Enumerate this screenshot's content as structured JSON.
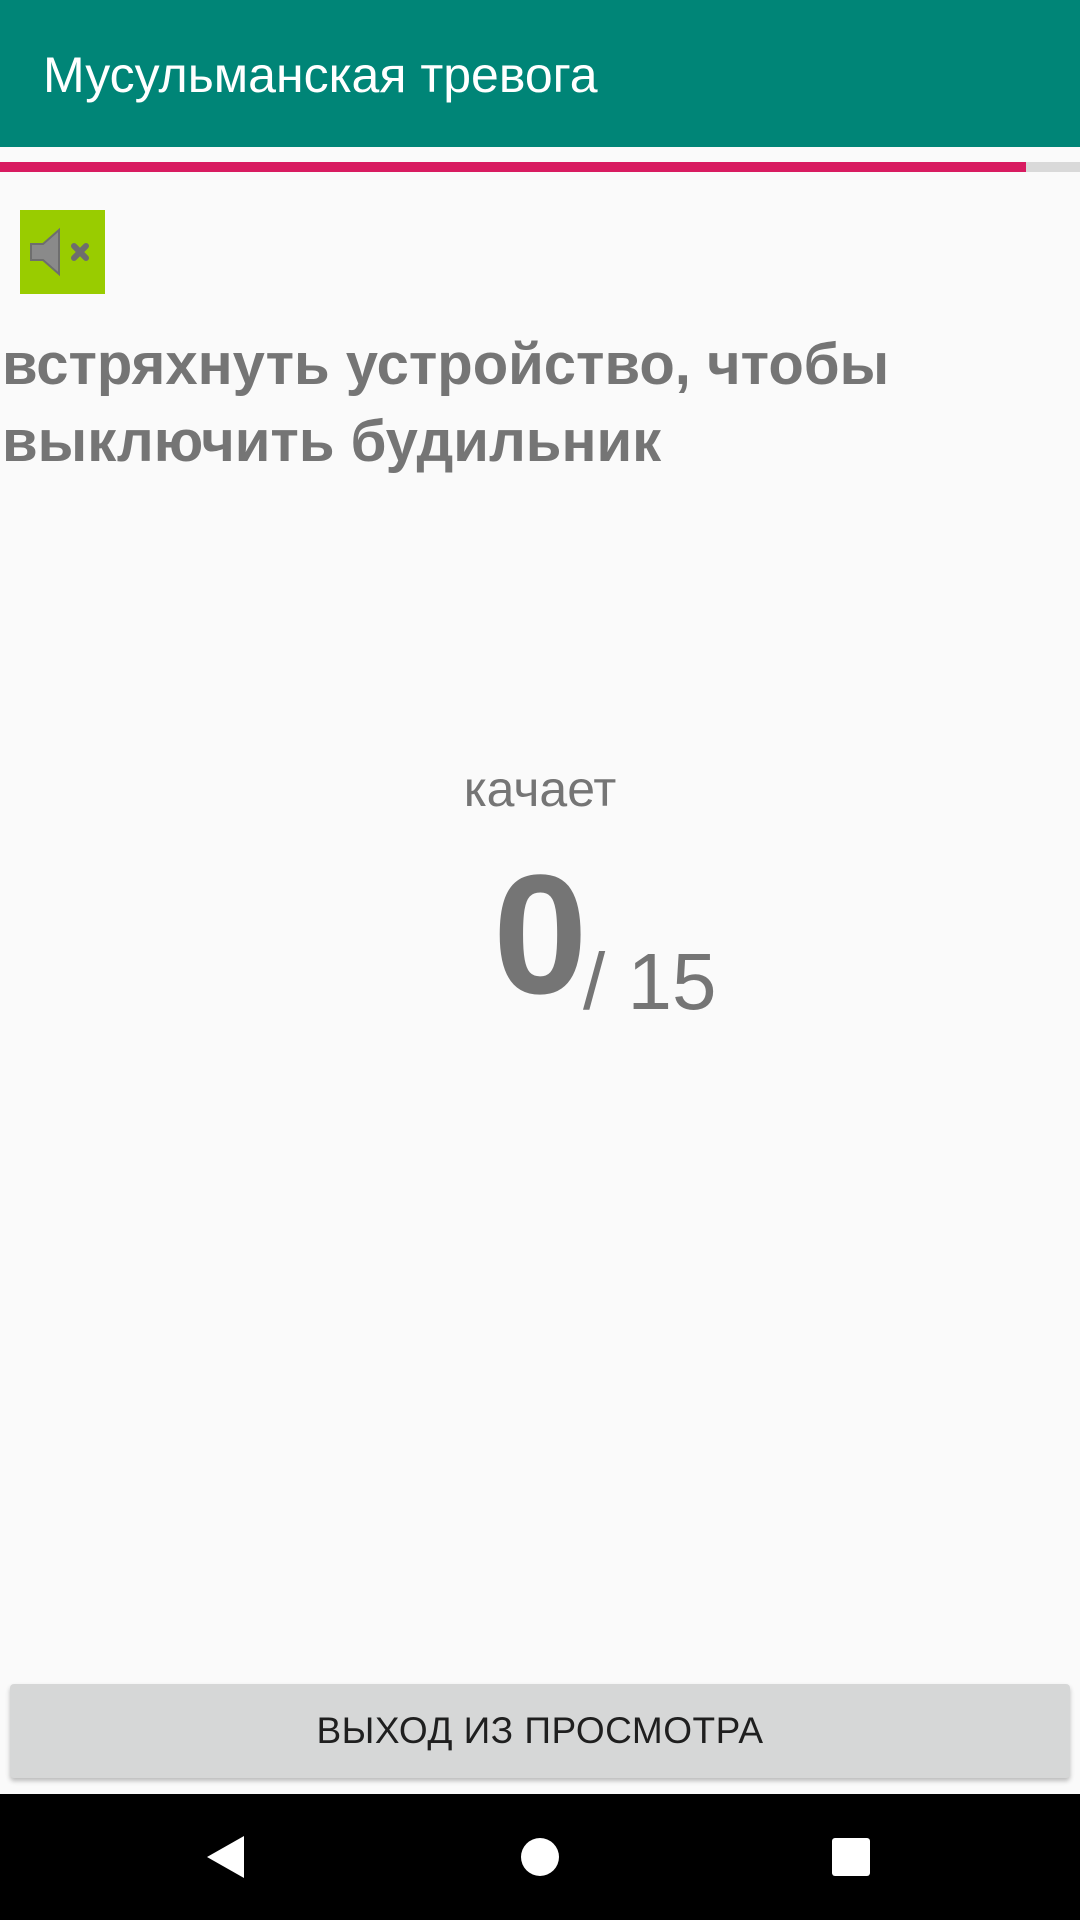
{
  "app_bar": {
    "title": "Мусульманская тревога",
    "color": "#008577"
  },
  "progress": {
    "fraction": 0.95,
    "color": "#d81b60"
  },
  "mute_button": {
    "icon": "volume-mute-icon",
    "color": "#99cc00"
  },
  "instruction": {
    "text": "встряхнуть устройство, чтобы выключить будильник"
  },
  "counter": {
    "label": "качает",
    "current": "0",
    "total": "/ 15"
  },
  "exit_button": {
    "label": "ВЫХОД ИЗ ПРОСМОТРА"
  },
  "nav_bar": {
    "items": [
      "back-icon",
      "home-icon",
      "recents-icon"
    ]
  }
}
